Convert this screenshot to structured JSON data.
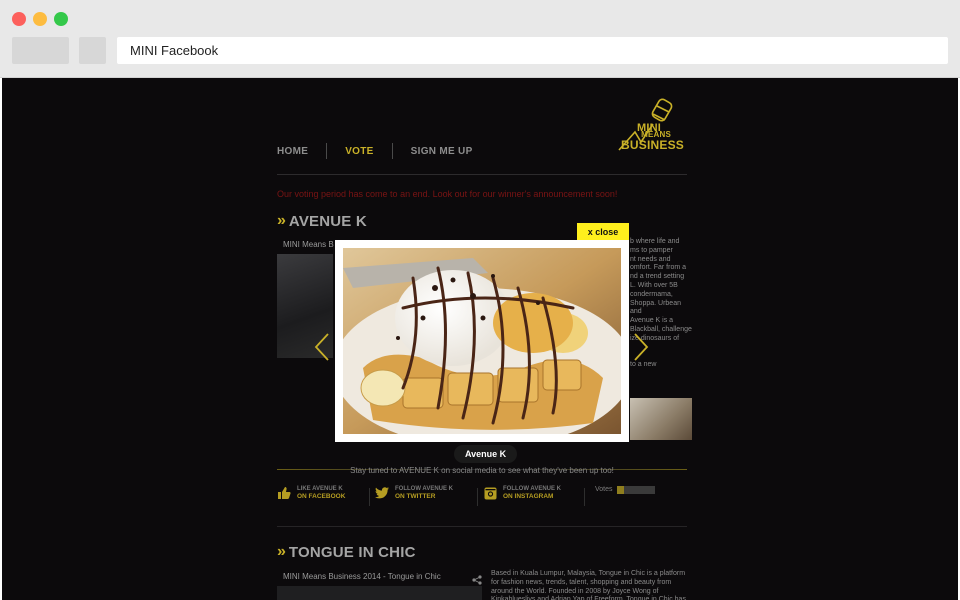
{
  "browser": {
    "url": "MINI Facebook"
  },
  "site": {
    "logo": {
      "line1": "MINI",
      "line2": "MEANS",
      "line3": "BUSINESS"
    },
    "nav": [
      {
        "label": "HOME",
        "active": false
      },
      {
        "label": "VOTE",
        "active": true
      },
      {
        "label": "SIGN ME UP",
        "active": false
      }
    ],
    "notice": "Our voting period has come to an end. Look out for our winner's announcement soon!",
    "accent_color": "#c9b128"
  },
  "entries": [
    {
      "title": "AVENUE K",
      "subtitle": "MINI Means B",
      "description_fragments": [
        "b where life and",
        "ms to pamper",
        "nt needs and",
        "omfort. Far from a",
        "nd a trend setting",
        "L. With over 5B",
        "condermama,",
        "Shoppa. Urbean and",
        "Avenue K is a",
        "Blackball, challenge",
        "ize dinosaurs of",
        "",
        "",
        "to a new"
      ],
      "stay_tuned": "Stay tuned to AVENUE K on social media to see what they've been up too!",
      "social": {
        "facebook": {
          "top": "LIKE AVENUE K",
          "bottom": "ON FACEBOOK"
        },
        "twitter": {
          "top": "FOLLOW AVENUE K",
          "bottom": "ON TWITTER"
        },
        "instagram": {
          "top": "FOLLOW AVENUE K",
          "bottom": "ON INSTAGRAM"
        }
      },
      "votes_label": "Votes",
      "votes_fraction": 0.18
    },
    {
      "title": "TONGUE IN CHIC",
      "subtitle": "MINI Means Business 2014 - Tongue in Chic",
      "description": "Based in Kuala Lumpur, Malaysia, Tongue in Chic is a platform for fashion news, trends, talent, shopping and beauty from around the World. Founded in 2008 by Joyce Wong of Kinkablueslivs and Adrian Yap of Freeform, Tongue in Chic has"
    }
  ],
  "modal": {
    "close_label": "x  close",
    "caption": "Avenue K"
  }
}
